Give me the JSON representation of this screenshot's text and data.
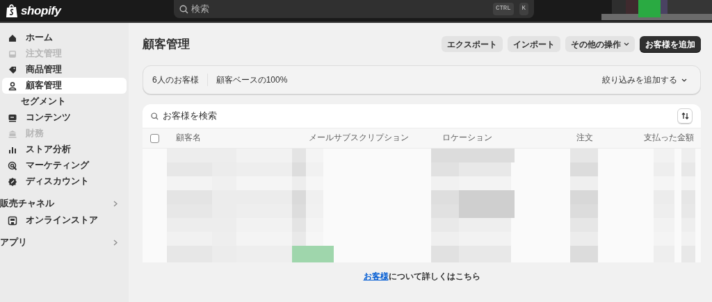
{
  "top_bar": {
    "brand": "shopify",
    "search": {
      "placeholder": "検索",
      "shortcut": [
        "CTRL",
        "K"
      ]
    }
  },
  "sidebar": [
    {
      "kind": "item",
      "label": "ホーム",
      "selected": false,
      "disabled": false
    },
    {
      "kind": "item",
      "label": "注文管理",
      "selected": false,
      "disabled": true
    },
    {
      "kind": "item",
      "label": "商品管理",
      "selected": false,
      "disabled": false
    },
    {
      "kind": "item",
      "label": "顧客管理",
      "selected": true,
      "disabled": false
    },
    {
      "kind": "subitem",
      "label": "セグメント",
      "selected": false,
      "disabled": false
    },
    {
      "kind": "item",
      "label": "コンテンツ",
      "selected": false,
      "disabled": false
    },
    {
      "kind": "item",
      "label": "財務",
      "selected": false,
      "disabled": true
    },
    {
      "kind": "item",
      "label": "ストア分析",
      "selected": false,
      "disabled": false
    },
    {
      "kind": "item",
      "label": "マーケティング",
      "selected": false,
      "disabled": false
    },
    {
      "kind": "item",
      "label": "ディスカウント",
      "selected": false,
      "disabled": false
    },
    {
      "kind": "section",
      "label": "販売チャネル"
    },
    {
      "kind": "item",
      "label": "オンラインストア",
      "selected": false,
      "disabled": false
    },
    {
      "kind": "section",
      "label": "アプリ"
    }
  ],
  "page": {
    "title": "顧客管理",
    "actions": [
      {
        "label": "エクスポート",
        "kind": "secondary"
      },
      {
        "label": "インポート",
        "kind": "secondary"
      },
      {
        "label": "その他の操作",
        "kind": "menu"
      },
      {
        "label": "お客様を追加",
        "kind": "primary"
      }
    ],
    "summary": {
      "count": "6人のお客様",
      "share": "顧客ベースの100%",
      "filter": "絞り込みを追加する"
    },
    "table": {
      "search": {
        "placeholder": "お客様を検索"
      },
      "select_all": {
        "checked": false
      },
      "columns": [
        "顧客名",
        "メールサブスクリプション",
        "ロケーション",
        "注文",
        "支払った金額"
      ]
    },
    "footer": {
      "link": "お客様",
      "text": "について詳しくはこちら"
    }
  }
}
